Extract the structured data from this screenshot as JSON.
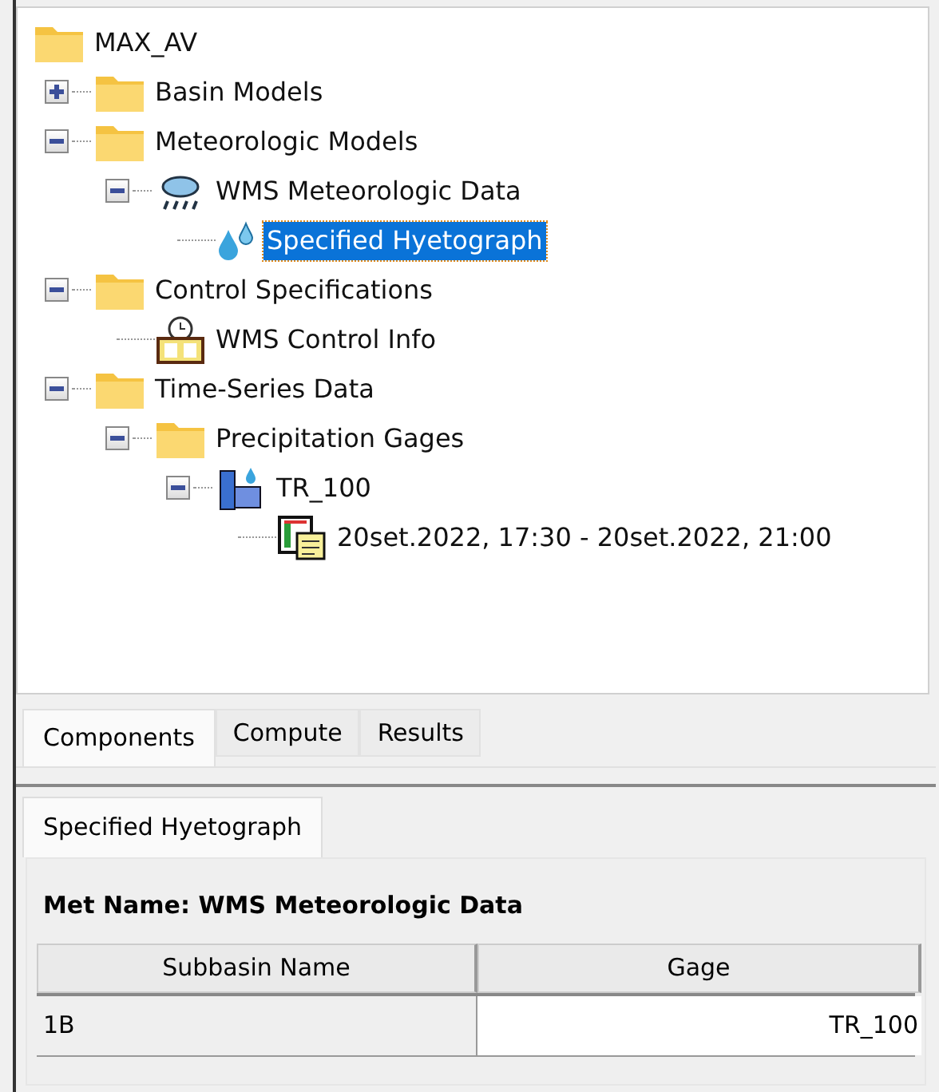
{
  "tree": [
    {
      "label": "MAX_AV",
      "kind": "folder",
      "selected": false,
      "children": [
        {
          "label": "Basin Models",
          "kind": "folder",
          "expanded": false,
          "selected": false
        },
        {
          "label": "Meteorologic Models",
          "kind": "folder",
          "expanded": true,
          "selected": false,
          "children": [
            {
              "label": "WMS Meteorologic Data",
              "kind": "weather",
              "expanded": true,
              "selected": false,
              "children": [
                {
                  "label": "Specified Hyetograph",
                  "kind": "drops",
                  "selected": true
                }
              ]
            }
          ]
        },
        {
          "label": "Control Specifications",
          "kind": "folder",
          "expanded": true,
          "selected": false,
          "children": [
            {
              "label": "WMS Control Info",
              "kind": "control",
              "selected": false
            }
          ]
        },
        {
          "label": "Time-Series Data",
          "kind": "folder",
          "expanded": true,
          "selected": false,
          "children": [
            {
              "label": "Precipitation Gages",
              "kind": "folder",
              "expanded": true,
              "selected": false,
              "children": [
                {
                  "label": "TR_100",
                  "kind": "gage",
                  "expanded": true,
                  "selected": false,
                  "children": [
                    {
                      "label": "20set.2022, 17:30 - 20set.2022, 21:00",
                      "kind": "timeseries",
                      "selected": false
                    }
                  ]
                }
              ]
            }
          ]
        }
      ]
    }
  ],
  "tabs": [
    {
      "label": "Components",
      "selected": true
    },
    {
      "label": "Compute",
      "selected": false
    },
    {
      "label": "Results",
      "selected": false
    }
  ],
  "editor_tab": {
    "label": "Specified Hyetograph",
    "selected": true
  },
  "met_name": {
    "label": "Met Name:",
    "value": "WMS Meteorologic Data"
  },
  "table": {
    "columns": [
      "Subbasin Name",
      "Gage"
    ],
    "rows": [
      [
        "1B",
        "TR_100"
      ]
    ]
  }
}
